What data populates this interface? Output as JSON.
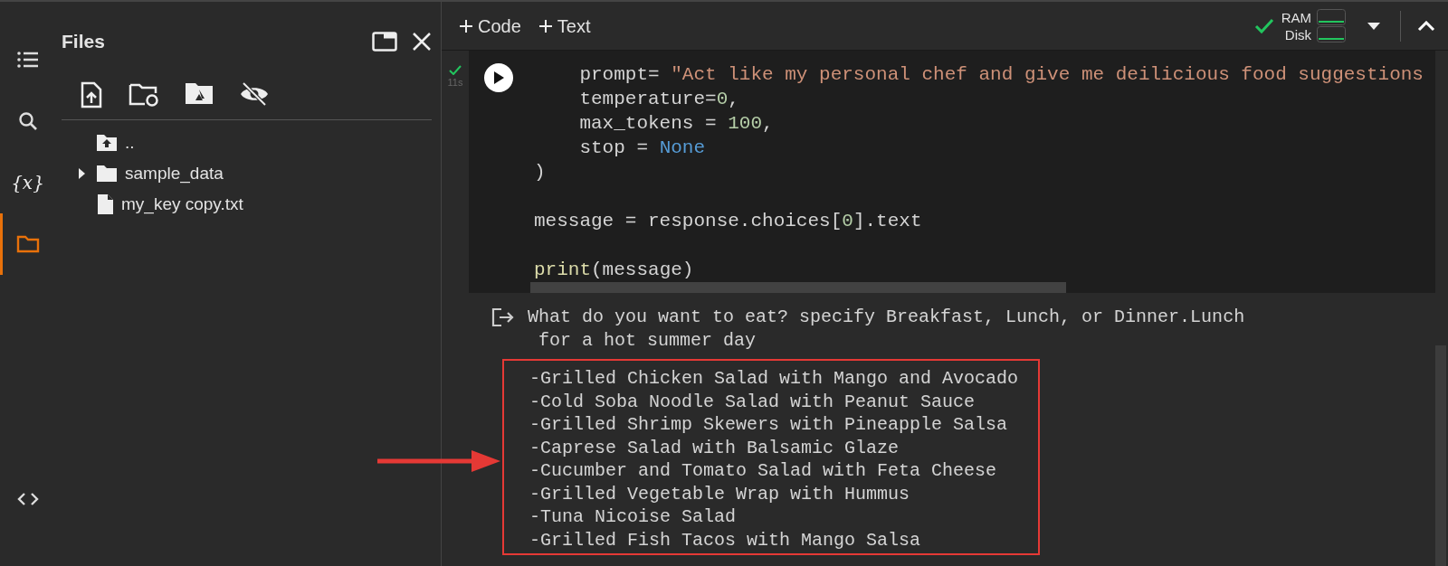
{
  "rail": [
    {
      "kind": "toc",
      "selected": false
    },
    {
      "kind": "search",
      "selected": false
    },
    {
      "kind": "variables",
      "label": "{x}",
      "selected": false
    },
    {
      "kind": "files",
      "selected": true
    },
    {
      "kind": "code",
      "selected": false
    }
  ],
  "files_panel": {
    "title": "Files",
    "tree": [
      {
        "kind": "parent",
        "name": ".."
      },
      {
        "kind": "folder",
        "name": "sample_data",
        "expanded": false
      },
      {
        "kind": "file",
        "name": "my_key copy.txt"
      }
    ]
  },
  "toolbar": {
    "buttons": [
      "Code",
      "Text"
    ],
    "meters": [
      {
        "label": "RAM"
      },
      {
        "label": "Disk"
      }
    ]
  },
  "cell": {
    "status": "11s",
    "lines": [
      {
        "kind": "code",
        "segments": [
          {
            "kind": "plain",
            "text": "    prompt= "
          },
          {
            "kind": "string",
            "text": "\"Act like my personal chef and give me deilicious food suggestions"
          }
        ]
      },
      {
        "kind": "code",
        "segments": [
          {
            "kind": "plain",
            "text": "    temperature="
          },
          {
            "kind": "number",
            "text": "0"
          },
          {
            "kind": "plain",
            "text": ","
          }
        ]
      },
      {
        "kind": "code",
        "segments": [
          {
            "kind": "plain",
            "text": "    max_tokens = "
          },
          {
            "kind": "number",
            "text": "100"
          },
          {
            "kind": "plain",
            "text": ","
          }
        ]
      },
      {
        "kind": "code",
        "segments": [
          {
            "kind": "plain",
            "text": "    stop = "
          },
          {
            "kind": "keyword",
            "text": "None"
          }
        ]
      },
      {
        "kind": "code",
        "segments": [
          {
            "kind": "plain",
            "text": ")"
          }
        ]
      },
      {
        "kind": "blank"
      },
      {
        "kind": "code",
        "segments": [
          {
            "kind": "plain",
            "text": "message = response.choices["
          },
          {
            "kind": "number",
            "text": "0"
          },
          {
            "kind": "plain",
            "text": "].text"
          }
        ]
      },
      {
        "kind": "blank"
      },
      {
        "kind": "code",
        "segments": [
          {
            "kind": "func",
            "text": "print"
          },
          {
            "kind": "plain",
            "text": "(message)"
          }
        ]
      }
    ]
  },
  "output": {
    "intro": [
      "What do you want to eat? specify Breakfast, Lunch, or Dinner.Lunch",
      " for a hot summer day"
    ],
    "suggestions": [
      "-Grilled Chicken Salad with Mango and Avocado",
      "-Cold Soba Noodle Salad with Peanut Sauce",
      "-Grilled Shrimp Skewers with Pineapple Salsa",
      "-Caprese Salad with Balsamic Glaze",
      "-Cucumber and Tomato Salad with Feta Cheese",
      "-Grilled Vegetable Wrap with Hummus",
      "-Tuna Nicoise Salad",
      "-Grilled Fish Tacos with Mango Salsa"
    ]
  }
}
